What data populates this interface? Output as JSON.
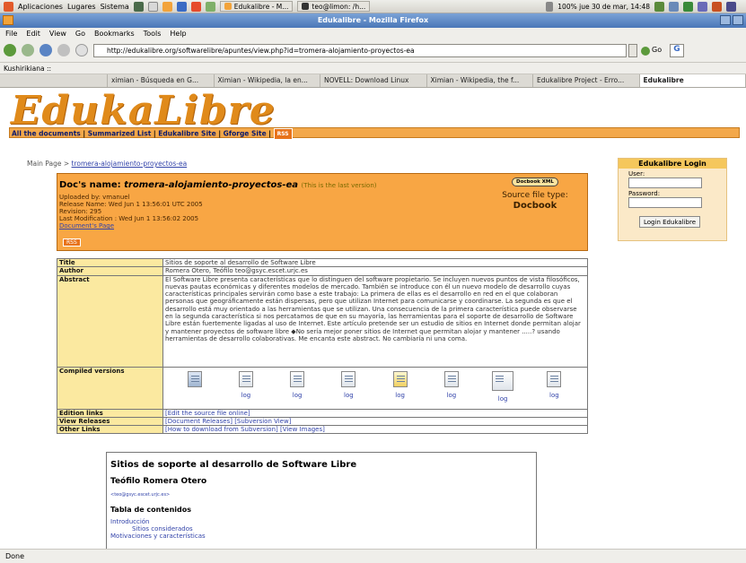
{
  "panel": {
    "apps": "Aplicaciones",
    "places": "Lugares",
    "system": "Sistema",
    "windows": [
      "Edukalibre - M...",
      "teo@limon: /h..."
    ],
    "status": "100% jue 30 de mar, 14:48"
  },
  "window_title": "Edukalibre - Mozilla Firefox",
  "menu": [
    "File",
    "Edit",
    "View",
    "Go",
    "Bookmarks",
    "Tools",
    "Help"
  ],
  "url": "http://edukalibre.org/softwarelibre/apuntes/view.php?id=tromera-alojamiento-proyectos-ea",
  "go_label": "Go",
  "bookmark_toolbar": "Kushirikiana ::",
  "tabs": [
    "ximian - Búsqueda en G...",
    "Ximian - Wikipedia, la en...",
    "NOVELL: Download Linux",
    "Ximian - Wikipedia, the f...",
    "Edukalibre Project - Erro...",
    "Edukalibre"
  ],
  "site": {
    "logo": "EdukaLibre",
    "nav": [
      "All the documents",
      "Summarized List",
      "Edukalibre Site",
      "Gforge Site"
    ],
    "rss": "RSS"
  },
  "breadcrumb": {
    "home": "Main Page",
    "sep": ">",
    "current": "tromera-alojamiento-proyectos-ea"
  },
  "login": {
    "title": "Edukalibre Login",
    "user_label": "User:",
    "password_label": "Password:",
    "button": "Login Edukalibre"
  },
  "doc": {
    "name_label": "Doc's name:",
    "name": "tromera-alojamiento-proyectos-ea",
    "last_version": "(This is the last version)",
    "uploaded_by": "Uploaded by: vmanuel",
    "release_name": "Release Name: Wed Jun 1 13:56:01 UTC 2005",
    "revision": "Revision: 295",
    "last_modification": "Last Modification : Wed Jun 1 13:56:02 2005",
    "doc_page": "Document's Page",
    "xml_badge": "Docbook XML",
    "source_type_label": "Source file type:",
    "source_type": "Docbook"
  },
  "info": {
    "title_k": "Title",
    "title_v": "Sitios de soporte al desarrollo de Software Libre",
    "author_k": "Author",
    "author_v": "Romera Otero, Teófilo teo@gsyc.escet.urjc.es",
    "abstract_k": "Abstract",
    "abstract_v": "El Software Libre presenta características que lo distinguen del software propietario. Se incluyen nuevos puntos de vista filosóficos, nuevas pautas económicas y diferentes modelos de mercado. También se introduce con él un nuevo modelo de desarrollo cuyas características principales servirán como base a este trabajo: La primera de ellas es el desarrollo en red en el que colaboran personas que geográficamente están dispersas, pero que utilizan Internet para comunicarse y coordinarse. La segunda es que el desarrollo está muy orientado a las herramientas que se utilizan. Una consecuencia de la primera característica puede observarse en la segunda característica si nos percatamos de que en su mayoría, las herramientas para el soporte de desarrollo de Software Libre están fuertemente ligadas al uso de Internet. Este artículo pretende ser un estudio de sitios en Internet donde permitan alojar y mantener proyectos de software libre ◆No sería mejor poner sitios de Internet que permitan alojar y mantener .....? usando herramientas de desarrollo colaborativas. Me encanta este abstract. No cambiaría ni una coma.",
    "compiled_k": "Compiled versions",
    "log_label": "log",
    "edition_k": "Edition links",
    "edition_v": "[Edit the source file online]",
    "releases_k": "View Releases",
    "releases_v1": "[Document Releases]",
    "releases_v2": "[Subversion View]",
    "other_k": "Other Links",
    "other_v1": "[How to download from Subversion]",
    "other_v2": "[View Images]"
  },
  "preview": {
    "title": "Sitios de soporte al desarrollo de Software Libre",
    "author": "Teófilo Romera Otero",
    "email": "<teo@gsyc.escet.urjc.es>",
    "toc_title": "Tabla de contenidos",
    "toc": [
      "Introducción",
      "Sitios considerados",
      "Motivaciones y características"
    ]
  },
  "status": "Done",
  "colors": {
    "orange": "#f8a644",
    "logo": "#e08a1a",
    "link": "#3344aa"
  }
}
